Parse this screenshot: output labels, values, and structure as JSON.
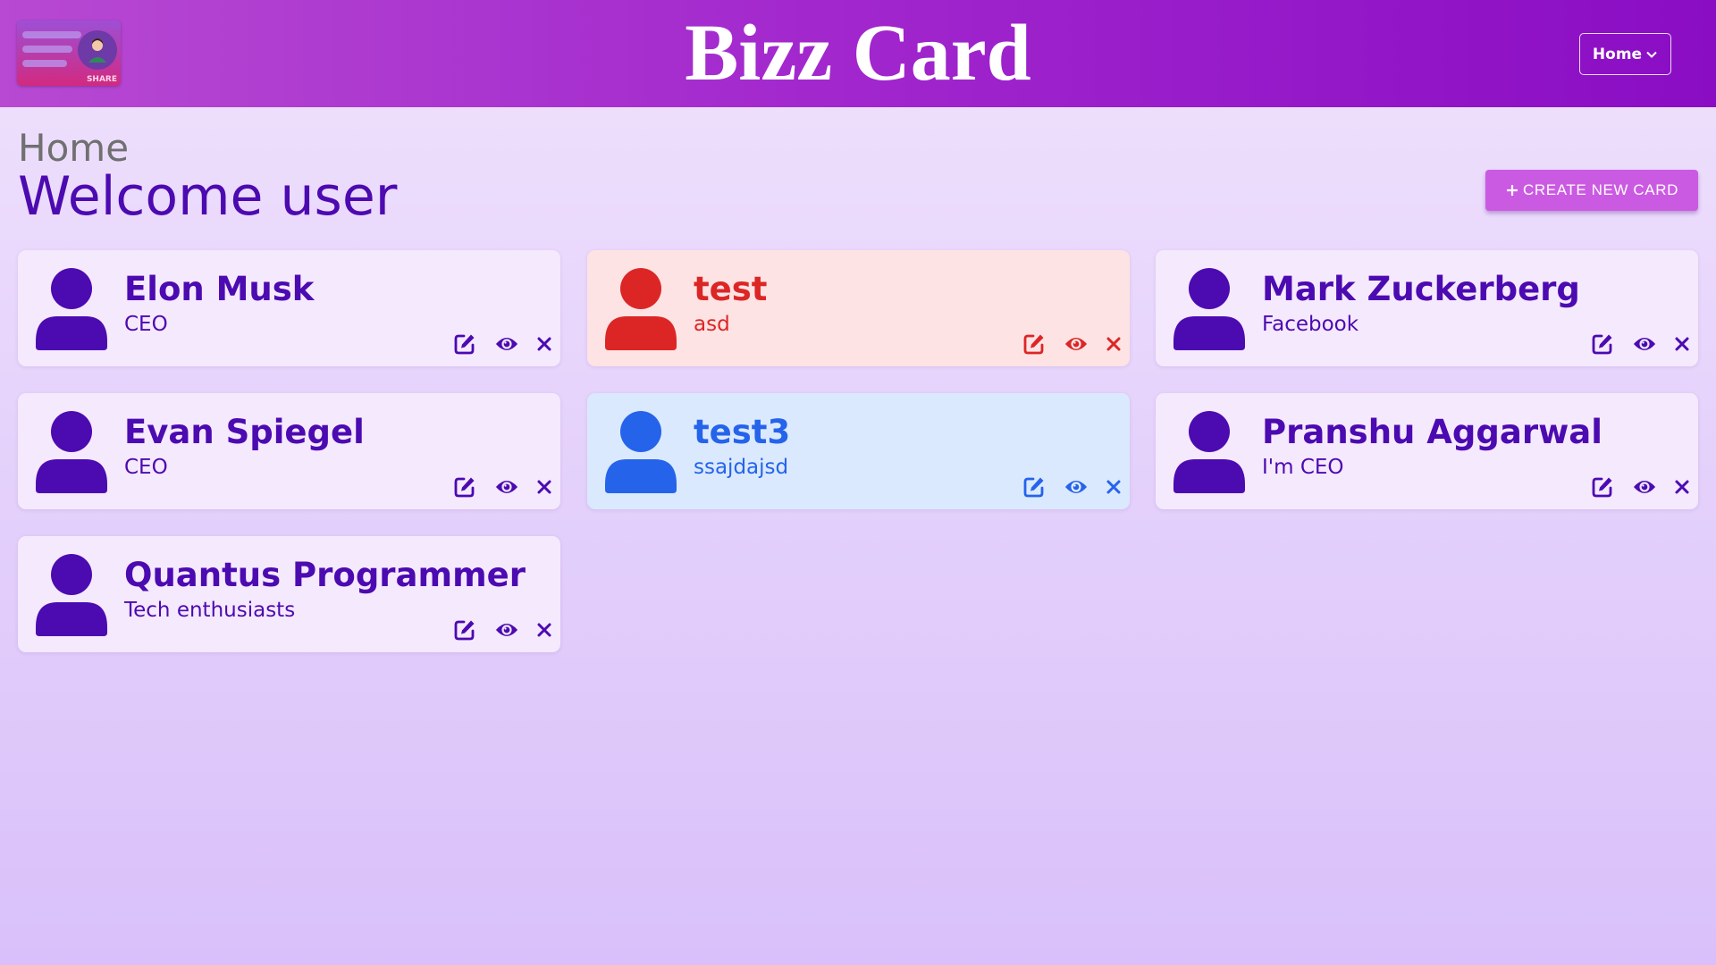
{
  "app": {
    "title": "Bizz Card",
    "logo_text": "SHARE"
  },
  "nav": {
    "home_label": "Home"
  },
  "page": {
    "breadcrumb": "Home",
    "welcome": "Welcome user",
    "create_label": "CREATE NEW CARD"
  },
  "colors": {
    "purple": "#4c0ab1",
    "red": "#dc2626",
    "blue": "#2563eb",
    "accent": "#cb5ae2"
  },
  "cards": [
    {
      "name": "Elon Musk",
      "subtitle": "CEO",
      "theme": "purple"
    },
    {
      "name": "test",
      "subtitle": "asd",
      "theme": "red"
    },
    {
      "name": "Mark Zuckerberg",
      "subtitle": "Facebook",
      "theme": "purple"
    },
    {
      "name": "Evan Spiegel",
      "subtitle": "CEO",
      "theme": "purple"
    },
    {
      "name": "test3",
      "subtitle": "ssajdajsd",
      "theme": "blue"
    },
    {
      "name": "Pranshu Aggarwal",
      "subtitle": "I'm CEO",
      "theme": "purple"
    },
    {
      "name": "Quantus Programmer",
      "subtitle": "Tech enthusiasts",
      "theme": "purple"
    }
  ],
  "icons": {
    "avatar": "user-icon",
    "edit": "edit-icon",
    "view": "eye-icon",
    "delete": "close-icon",
    "add": "plus-icon",
    "dropdown": "chevron-down-icon"
  }
}
